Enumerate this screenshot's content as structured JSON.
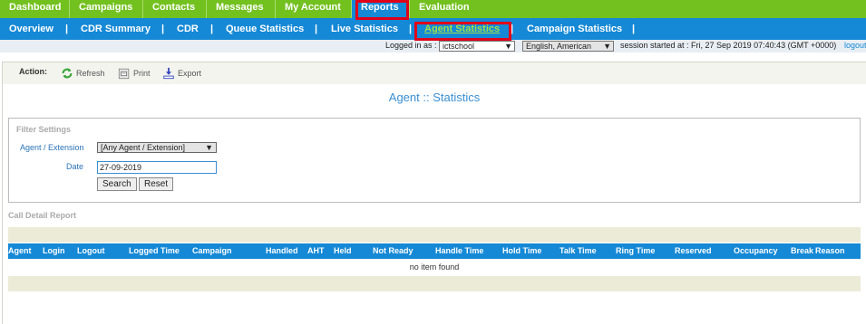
{
  "top_nav": [
    {
      "label": "Dashboard"
    },
    {
      "label": "Campaigns"
    },
    {
      "label": "Contacts"
    },
    {
      "label": "Messages"
    },
    {
      "label": "My Account"
    },
    {
      "label": "Reports"
    },
    {
      "label": "Evaluation"
    }
  ],
  "sub_nav": {
    "items": [
      {
        "label": "Overview"
      },
      {
        "label": "CDR Summary"
      },
      {
        "label": "CDR"
      },
      {
        "label": "Queue Statistics"
      },
      {
        "label": "Live Statistics"
      },
      {
        "label": "Agent Statistics"
      },
      {
        "label": "Campaign Statistics"
      }
    ],
    "separator": "|"
  },
  "status_bar": {
    "logged_in_label": "Logged in as :",
    "user": "ictschool",
    "language": "English, American",
    "session_text": "session started at : Fri, 27 Sep 2019 07:40:43 (GMT +0000)",
    "logout_label": "logout"
  },
  "toolbar": {
    "action_label": "Action:",
    "refresh_label": "Refresh",
    "print_label": "Print",
    "export_label": "Export"
  },
  "page_title": "Agent :: Statistics",
  "filter": {
    "title": "Filter Settings",
    "agent_label": "Agent / Extension",
    "agent_value": "[Any Agent / Extension]",
    "date_label": "Date",
    "date_value": "27-09-2019",
    "search_label": "Search",
    "reset_label": "Reset"
  },
  "report": {
    "title": "Call Detail Report",
    "columns": [
      "Agent",
      "Login",
      "Logout",
      "Logged Time",
      "Campaign",
      "Handled",
      "AHT",
      "Held",
      "Not Ready",
      "Handle Time",
      "Hold Time",
      "Talk Time",
      "Ring Time",
      "Reserved",
      "Occupancy",
      "Break",
      "Reason"
    ],
    "empty_text": "no item found"
  },
  "colors": {
    "top_nav_bg": "#73c11f",
    "sub_nav_bg": "#1589d6",
    "active_subnav_text": "#9fe04a",
    "highlight": "#e0001a"
  },
  "icons": [
    "refresh-icon",
    "print-icon",
    "export-icon",
    "dropdown-arrow-icon"
  ]
}
